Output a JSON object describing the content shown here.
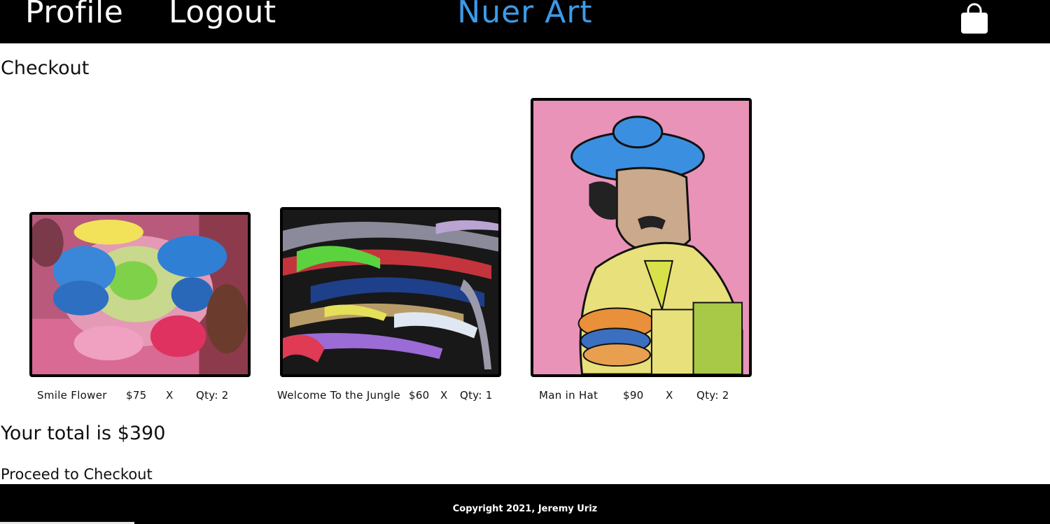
{
  "nav": {
    "profile": "Profile",
    "logout": "Logout",
    "brand": "Nuer Art",
    "cart_icon": "shopping-bag-icon",
    "brand_color": "#3b9be8"
  },
  "page": {
    "title": "Checkout"
  },
  "items": [
    {
      "title": "Smile Flower",
      "price": "$75",
      "remove": "X",
      "qty": "Qty: 2"
    },
    {
      "title": "Welcome To the Jungle",
      "price": "$60",
      "remove": "X",
      "qty": "Qty: 1"
    },
    {
      "title": "Man in Hat",
      "price": "$90",
      "remove": "X",
      "qty": "Qty: 2"
    }
  ],
  "summary": {
    "total": "Your total is $390",
    "proceed": "Proceed to Checkout"
  },
  "footer": {
    "copyright": "Copyright 2021, Jeremy Uriz"
  }
}
